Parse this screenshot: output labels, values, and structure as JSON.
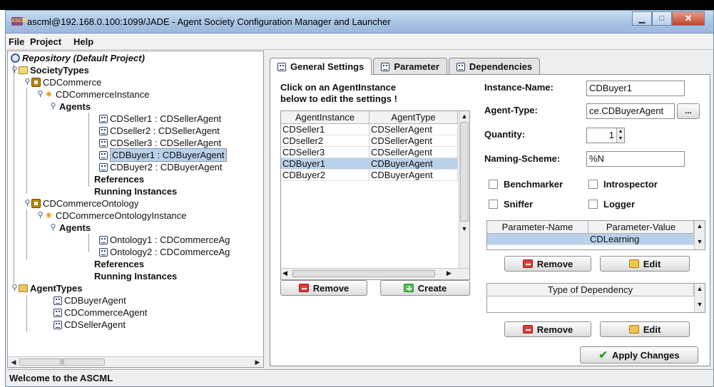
{
  "window": {
    "title": "ascml@192.168.0.100:1099/JADE - Agent Society Configuration Manager and Launcher",
    "app_icon": "ASCML"
  },
  "menu": [
    "File",
    "Project",
    "Help"
  ],
  "tree": {
    "nodes": [
      {
        "label": "Repository (Default Project)",
        "icon": "repository-icon"
      },
      {
        "label": "SocietyTypes",
        "icon": "open-folder-icon"
      },
      {
        "label": "CDCommerce",
        "icon": "society-type-icon"
      },
      {
        "label": "CDCommerceInstance",
        "icon": "society-instance-icon"
      },
      {
        "label": "Agents",
        "icon": "none"
      },
      {
        "label": "CDSeller1 : CDSellerAgent",
        "icon": "agent-icon"
      },
      {
        "label": "CDseller2 : CDSellerAgent",
        "icon": "agent-icon"
      },
      {
        "label": "CDSeller3 : CDSellerAgent",
        "icon": "agent-icon"
      },
      {
        "label": "CDBuyer1 : CDBuyerAgent",
        "icon": "agent-icon"
      },
      {
        "label": "CDBuyer2 : CDBuyerAgent",
        "icon": "agent-icon"
      },
      {
        "label": "References",
        "icon": "none"
      },
      {
        "label": "Running Instances",
        "icon": "none"
      },
      {
        "label": "CDCommerceOntology",
        "icon": "society-type-icon"
      },
      {
        "label": "CDCommerceOntologyInstance",
        "icon": "society-instance-icon"
      },
      {
        "label": "Agents",
        "icon": "none"
      },
      {
        "label": "Ontology1 : CDCommerceAg",
        "icon": "agent-icon"
      },
      {
        "label": "Ontology2 : CDCommerceAg",
        "icon": "agent-icon"
      },
      {
        "label": "References",
        "icon": "none"
      },
      {
        "label": "Running Instances",
        "icon": "none"
      },
      {
        "label": "AgentTypes",
        "icon": "folder-icon"
      },
      {
        "label": "CDBuyerAgent",
        "icon": "agent-icon"
      },
      {
        "label": "CDCommerceAgent",
        "icon": "agent-icon"
      },
      {
        "label": "CDSellerAgent",
        "icon": "agent-icon"
      }
    ]
  },
  "status": "Welcome to the ASCML",
  "tabs": [
    "General Settings",
    "Parameter",
    "Dependencies"
  ],
  "general": {
    "instruction_line1": "Click on an AgentInstance",
    "instruction_line2": "below to edit the settings !",
    "table": {
      "headers": [
        "AgentInstance",
        "AgentType"
      ],
      "rows": [
        [
          "CDSeller1",
          "CDSellerAgent"
        ],
        [
          "CDseller2",
          "CDSellerAgent"
        ],
        [
          "CDSeller3",
          "CDSellerAgent"
        ],
        [
          "CDBuyer1",
          "CDBuyerAgent"
        ],
        [
          "CDBuyer2",
          "CDBuyerAgent"
        ]
      ]
    },
    "remove_label": "Remove",
    "create_label": "Create",
    "instance_name_label": "Instance-Name:",
    "instance_name_value": "CDBuyer1",
    "agent_type_label": "Agent-Type:",
    "agent_type_value": "ce.CDBuyerAgent",
    "browse_label": "...",
    "quantity_label": "Quantity:",
    "quantity_value": "1",
    "naming_label": "Naming-Scheme:",
    "naming_value": "%N",
    "checkboxes": [
      "Benchmarker",
      "Introspector",
      "Sniffer",
      "Logger"
    ],
    "param_table": {
      "headers": [
        "Parameter-Name",
        "Parameter-Value"
      ],
      "rows": [
        [
          "",
          "CDLearning"
        ]
      ]
    },
    "param_remove": "Remove",
    "param_edit": "Edit",
    "dep_table": {
      "header": "Type of Dependency"
    },
    "dep_remove": "Remove",
    "dep_edit": "Edit",
    "apply_label": "Apply Changes"
  }
}
